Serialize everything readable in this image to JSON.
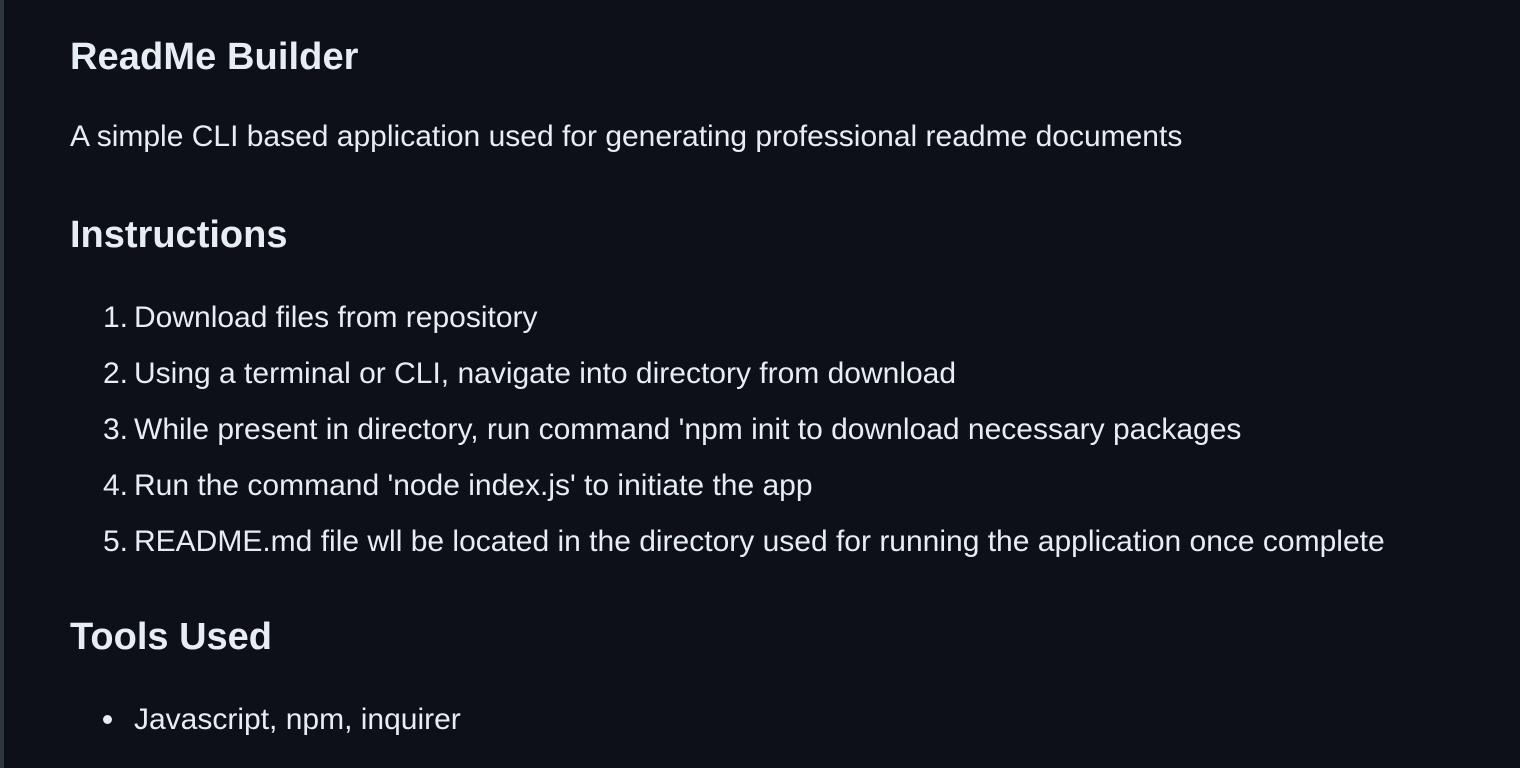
{
  "readme": {
    "title": "ReadMe Builder",
    "description": "A simple CLI based application used for generating professional readme documents",
    "instructions": {
      "heading": "Instructions",
      "steps": [
        {
          "num": "1.",
          "text": "Download files from repository"
        },
        {
          "num": "2.",
          "text": "Using a terminal or CLI, navigate into directory from download"
        },
        {
          "num": "3.",
          "text": "While present in directory, run command 'npm init to download necessary packages"
        },
        {
          "num": "4.",
          "text": "Run the command 'node index.js' to initiate the app"
        },
        {
          "num": "5.",
          "text": "README.md file wll be located in the directory used for running the application once complete"
        }
      ]
    },
    "tools": {
      "heading": "Tools Used",
      "items": [
        "Javascript, npm, inquirer"
      ]
    }
  }
}
